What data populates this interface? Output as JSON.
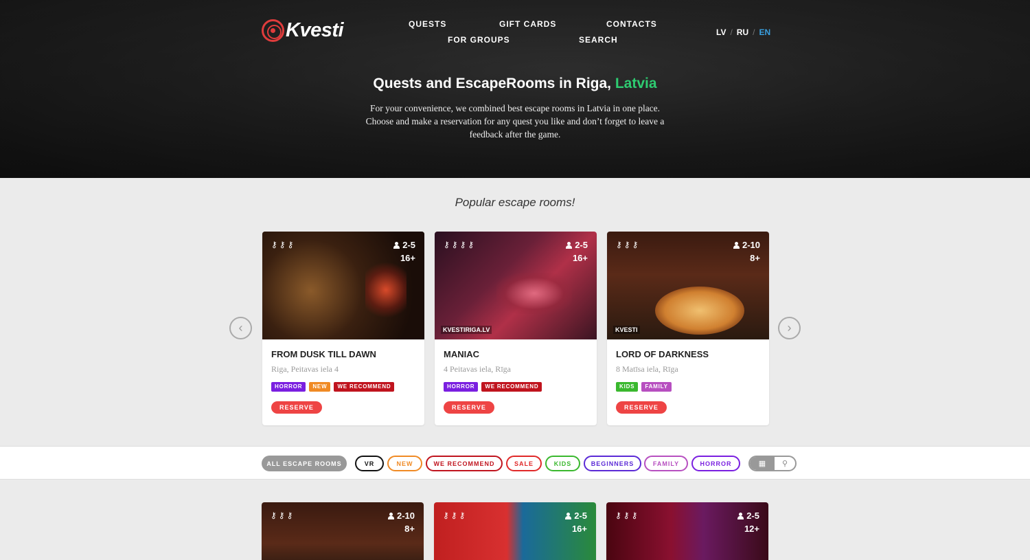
{
  "header": {
    "logo_text": "Kvesti",
    "nav": {
      "quests": "QUESTS",
      "gift_cards": "GIFT CARDS",
      "contacts": "CONTACTS",
      "for_groups": "FOR GROUPS",
      "search": "SEARCH"
    },
    "languages": [
      "LV",
      "RU",
      "EN"
    ],
    "active_language": "EN",
    "active_language_color": "#3aa0e0"
  },
  "hero": {
    "title_prefix": "Quests and EscapeRooms in Riga, ",
    "title_accent": "Latvia",
    "accent_color": "#2ecc71",
    "description": "For your convenience, we combined best escape rooms in Latvia in one place. Choose and make a reservation for any quest you like and don’t forget to leave a feedback after the game."
  },
  "popular": {
    "title": "Popular escape rooms!",
    "prev_icon": "chevron-left-icon",
    "next_icon": "chevron-right-icon",
    "cards": [
      {
        "title": "FROM DUSK TILL DAWN",
        "address": "Riga, Peitavas iela 4",
        "players": "2-5",
        "age": "16+",
        "difficulty_keys": 3,
        "watermark": "",
        "tags": [
          "HORROR",
          "NEW",
          "WE RECOMMEND"
        ],
        "reserve_label": "RESERVE"
      },
      {
        "title": "MANIAC",
        "address": "4 Peitavas iela, Rīga",
        "players": "2-5",
        "age": "16+",
        "difficulty_keys": 4,
        "watermark": "KVESTIRIGA.LV",
        "tags": [
          "HORROR",
          "WE RECOMMEND"
        ],
        "reserve_label": "RESERVE"
      },
      {
        "title": "LORD OF DARKNESS",
        "address": "8 Matīsa iela, Rīga",
        "players": "2-10",
        "age": "8+",
        "difficulty_keys": 3,
        "watermark": "KVESTI",
        "tags": [
          "KIDS",
          "FAMILY"
        ],
        "reserve_label": "RESERVE"
      }
    ]
  },
  "tag_colors": {
    "HORROR": "#7a1fe0",
    "NEW": "#f08a24",
    "WE RECOMMEND": "#c0141e",
    "KIDS": "#3ab82e",
    "FAMILY": "#b74fc0"
  },
  "filters": {
    "all": "ALL ESCAPE ROOMS",
    "vr": "VR",
    "new": "NEW",
    "we_recommend": "WE RECOMMEND",
    "sale": "SALE",
    "kids": "KIDS",
    "beginners": "BEGINNERS",
    "family": "FAMILY",
    "horror": "HORROR",
    "view_grid_icon": "grid-icon",
    "view_map_icon": "map-pin-icon"
  },
  "listing": {
    "cards": [
      {
        "players": "2-10",
        "age": "8+",
        "difficulty_keys": 3
      },
      {
        "players": "2-5",
        "age": "16+",
        "difficulty_keys": 3
      },
      {
        "players": "2-5",
        "age": "12+",
        "difficulty_keys": 3
      }
    ]
  }
}
